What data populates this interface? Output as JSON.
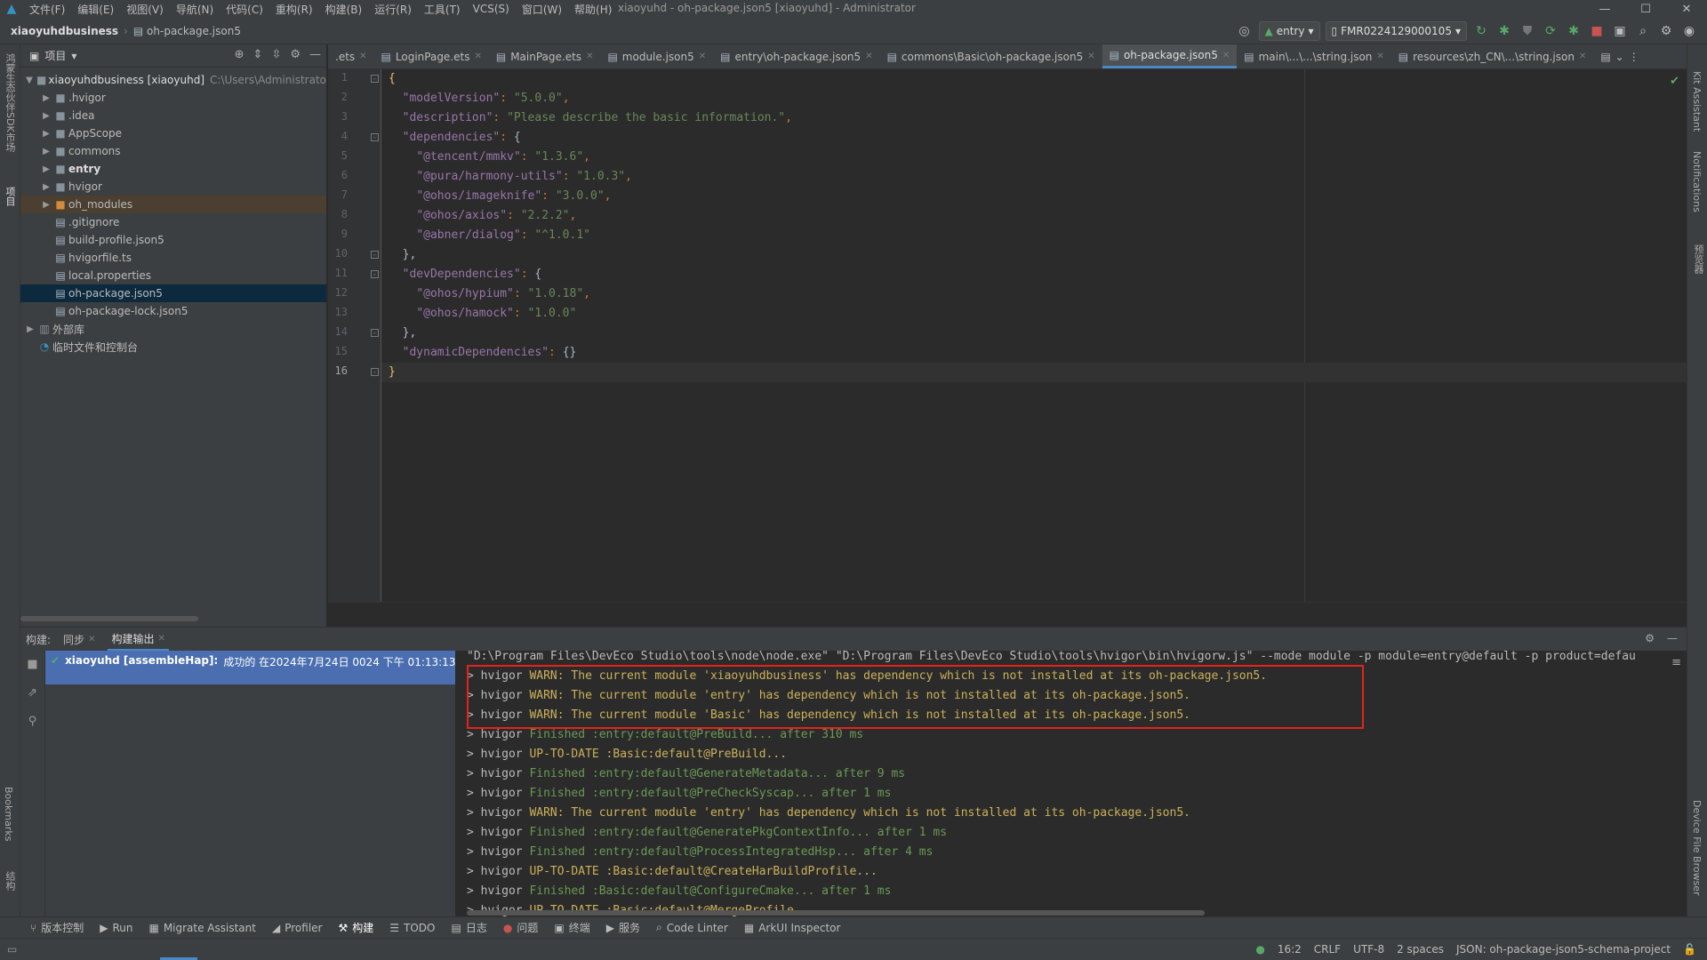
{
  "menubar": {
    "items": [
      "文件(F)",
      "编辑(E)",
      "视图(V)",
      "导航(N)",
      "代码(C)",
      "重构(R)",
      "构建(B)",
      "运行(R)",
      "工具(T)",
      "VCS(S)",
      "窗口(W)",
      "帮助(H)"
    ],
    "window_title": "xiaoyuhd - oh-package.json5 [xiaoyuhd] - Administrator"
  },
  "breadcrumb": {
    "project": "xiaoyuhdbusiness",
    "file": "oh-package.json5"
  },
  "toolbar": {
    "run_config": "entry",
    "device": "FMR0224129000105"
  },
  "left_strip": {
    "labels": [
      "鸿蒙生态伙伴SDK市场",
      "项目",
      "Bookmarks",
      "结构"
    ]
  },
  "right_strip": {
    "labels": [
      "Kit Assistant",
      "Notifications",
      "预览器",
      "Device File Browser"
    ]
  },
  "project_panel": {
    "title": "项目",
    "root_name": "xiaoyuhdbusiness [xiaoyuhd]",
    "root_path": "C:\\Users\\Administrato",
    "items": [
      ".hvigor",
      ".idea",
      "AppScope",
      "commons",
      "entry",
      "hvigor",
      "oh_modules",
      ".gitignore",
      "build-profile.json5",
      "hvigorfile.ts",
      "local.properties",
      "oh-package.json5",
      "oh-package-lock.json5"
    ],
    "external": "外部库",
    "scratches": "临时文件和控制台"
  },
  "tabs": [
    {
      "label": ".ets"
    },
    {
      "label": "LoginPage.ets"
    },
    {
      "label": "MainPage.ets"
    },
    {
      "label": "module.json5"
    },
    {
      "label": "entry\\oh-package.json5"
    },
    {
      "label": "commons\\Basic\\oh-package.json5"
    },
    {
      "label": "oh-package.json5"
    },
    {
      "label": "main\\...\\...\\string.json"
    },
    {
      "label": "resources\\zh_CN\\...\\string.json"
    }
  ],
  "editor": {
    "line_numbers": [
      "1",
      "2",
      "3",
      "4",
      "5",
      "6",
      "7",
      "8",
      "9",
      "10",
      "11",
      "12",
      "13",
      "14",
      "15",
      "16"
    ],
    "lines": {
      "l1": "{",
      "l2k": "\"modelVersion\"",
      "l2v": "\"5.0.0\"",
      "l3k": "\"description\"",
      "l3v": "\"Please describe the basic information.\"",
      "l4k": "\"dependencies\"",
      "l4v": "{",
      "l5k": "\"@tencent/mmkv\"",
      "l5v": "\"1.3.6\"",
      "l6k": "\"@pura/harmony-utils\"",
      "l6v": "\"1.0.3\"",
      "l7k": "\"@ohos/imageknife\"",
      "l7v": "\"3.0.0\"",
      "l8k": "\"@ohos/axios\"",
      "l8v": "\"2.2.2\"",
      "l9k": "\"@abner/dialog\"",
      "l9v": "\"^1.0.1\"",
      "l10": "},",
      "l11k": "\"devDependencies\"",
      "l11v": "{",
      "l12k": "\"@ohos/hypium\"",
      "l12v": "\"1.0.18\"",
      "l13k": "\"@ohos/hamock\"",
      "l13v": "\"1.0.0\"",
      "l14": "},",
      "l15k": "\"dynamicDependencies\"",
      "l15v": "{}",
      "l16": "}"
    }
  },
  "build_panel": {
    "title": "构建:",
    "tabs": [
      "同步",
      "构建输出"
    ],
    "task": "xiaoyuhd [assembleHap]:",
    "task_status": "成功的 在2024年7月24日 0024 下午 01:13:13",
    "command": "\"D:\\Program Files\\DevEco Studio\\tools\\node\\node.exe\" \"D:\\Program Files\\DevEco Studio\\tools\\hvigor\\bin\\hvigorw.js\" --mode module -p module=entry@default -p product=defau",
    "log": [
      {
        "prefix": "> hvigor ",
        "text": "WARN: The current module 'xiaoyuhdbusiness' has dependency which is not installed at its oh-package.json5."
      },
      {
        "prefix": "> hvigor ",
        "text": "WARN: The current module 'entry' has dependency which is not installed at its oh-package.json5."
      },
      {
        "prefix": "> hvigor ",
        "text": "WARN: The current module 'Basic' has dependency which is not installed at its oh-package.json5."
      },
      {
        "prefix": "> hvigor ",
        "text": "Finished :entry:default@PreBuild... after 310 ms"
      },
      {
        "prefix": "> hvigor ",
        "text": "UP-TO-DATE :Basic:default@PreBuild..."
      },
      {
        "prefix": "> hvigor ",
        "text": "Finished :entry:default@GenerateMetadata... after 9 ms"
      },
      {
        "prefix": "> hvigor ",
        "text": "Finished :entry:default@PreCheckSyscap... after 1 ms"
      },
      {
        "prefix": "> hvigor ",
        "text": "WARN: The current module 'entry' has dependency which is not installed at its oh-package.json5."
      },
      {
        "prefix": "> hvigor ",
        "text": "Finished :entry:default@GeneratePkgContextInfo... after 1 ms"
      },
      {
        "prefix": "> hvigor ",
        "text": "Finished :entry:default@ProcessIntegratedHsp... after 4 ms"
      },
      {
        "prefix": "> hvigor ",
        "text": "UP-TO-DATE :Basic:default@CreateHarBuildProfile..."
      },
      {
        "prefix": "> hvigor ",
        "text": "Finished :Basic:default@ConfigureCmake... after 1 ms"
      },
      {
        "prefix": "> hvigor ",
        "text": "UP-TO-DATE :Basic:default@MergeProfile..."
      }
    ]
  },
  "bottom_tools": [
    "版本控制",
    "Run",
    "Migrate Assistant",
    "Profiler",
    "构建",
    "TODO",
    "日志",
    "问题",
    "终端",
    "服务",
    "Code Linter",
    "ArkUI Inspector"
  ],
  "status": {
    "position": "16:2",
    "line_sep": "CRLF",
    "encoding": "UTF-8",
    "indent": "2 spaces",
    "schema": "JSON: oh-package-json5-schema-project"
  },
  "colors": {
    "warn": "#ccb15a",
    "success": "#6a9955",
    "highlight_box": "#e3241b",
    "accent": "#4a88c7"
  }
}
